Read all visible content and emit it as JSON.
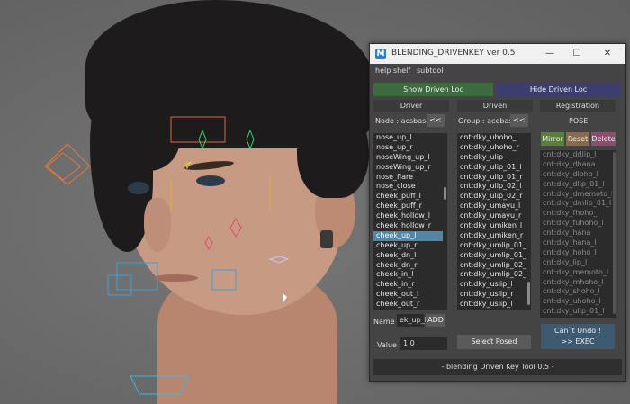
{
  "window": {
    "title": "BLENDING_DRIVENKEY  ver 0.5",
    "logo_letter": "M",
    "controls": [
      "—",
      "☐",
      "✕"
    ]
  },
  "menu": [
    "help",
    "shelf",
    "subtool"
  ],
  "top_buttons": {
    "show": "Show Driven Loc",
    "hide": "Hide Driven Loc"
  },
  "colors": {
    "show_btn": "#3e6b3e",
    "hide_btn": "#3b3e6e",
    "selected": "#5285a6",
    "mirror": "#5a7f3a",
    "reset": "#8a6a48",
    "delete": "#8c4d6e",
    "exec": "#3e5a70"
  },
  "driver": {
    "header": "Driver",
    "node_label": "Node : acsbase",
    "arrow": "<<",
    "items": [
      "nose_up_l",
      "nose_up_r",
      "noseWing_up_l",
      "noseWing_up_r",
      "nose_flare",
      "nose_close",
      "cheek_puff_l",
      "cheek_puff_r",
      "cheek_hollow_l",
      "cheek_hollow_r",
      "cheek_up_l",
      "cheek_up_r",
      "cheek_dn_l",
      "cheek_dn_r",
      "cheek_in_l",
      "cheek_in_r",
      "cheek_out_l",
      "cheek_out_r"
    ],
    "selected_index": 10,
    "name_label": "Name :",
    "name_value": "ek_up_l",
    "add_label": "ADD",
    "value_label": "Value :",
    "value": "1.0"
  },
  "driven": {
    "header": "Driven",
    "group_label": "Group : acebase",
    "arrow": "<<",
    "items": [
      "cnt:dky_uhoho_l",
      "cnt:dky_uhoho_r",
      "cnt:dky_ulip",
      "cnt:dky_ulip_01_l",
      "cnt:dky_ulip_01_r",
      "cnt:dky_ulip_02_l",
      "cnt:dky_ulip_02_r",
      "cnt:dky_umayu_l",
      "cnt:dky_umayu_r",
      "cnt:dky_umiken_l",
      "cnt:dky_umiken_r",
      "cnt:dky_umlip_01_l",
      "cnt:dky_umlip_01_r",
      "cnt:dky_umlip_02_l",
      "cnt:dky_umlip_02_r",
      "cnt:dky_uslip_l",
      "cnt:dky_uslip_r",
      "cnt:dky_uslip_l",
      "cnt:dky_uulip_r",
      "cnt:dky_wklowup_l"
    ],
    "select_posed": "Select Posed"
  },
  "registration": {
    "header": "Registration",
    "pose_label": "POSE",
    "mirror": "Mirror",
    "reset": "Reset",
    "delete": "Delete",
    "poses": [
      "cnt:dky_ddlip_l",
      "cnt:dky_dhana",
      "cnt:dky_dloho_l",
      "cnt:dky_dlip_01_l",
      "cnt:dky_dmemoto_l",
      "cnt:dky_dmlip_01_l",
      "cnt:dky_fhoho_l",
      "cnt:dky_fuhoho_l",
      "cnt:dky_hana",
      "cnt:dky_hana_l",
      "cnt:dky_hoho_l",
      "cnt:dky_lip_l",
      "cnt:dky_memoto_l",
      "cnt:dky_mhoho_l",
      "cnt:dky_shoho_l",
      "cnt:dky_uhoho_l",
      "cnt:dky_ulip_01_l"
    ],
    "undo_line1": "Can`t Undo !",
    "undo_line2": ">> EXEC"
  },
  "status": "-  blending Driven Key Tool  0.5  -"
}
